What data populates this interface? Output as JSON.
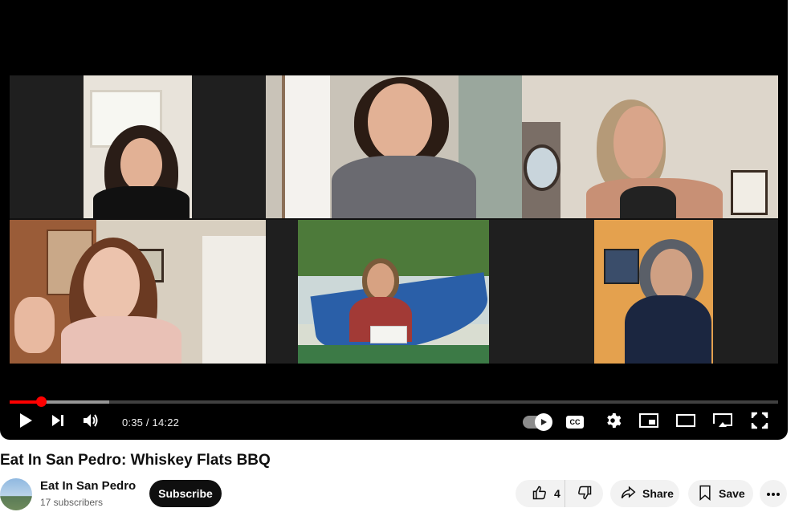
{
  "video": {
    "title": "Eat In San Pedro: Whiskey Flats BBQ",
    "current_time": "0:35",
    "duration": "14:22",
    "time_display": "0:35 / 14:22",
    "progress_played": 0.041,
    "progress_loaded": 0.13,
    "autoplay_on": true,
    "captions_label": "CC"
  },
  "channel": {
    "name": "Eat In San Pedro",
    "subscribers": "17 subscribers",
    "subscribe_label": "Subscribe"
  },
  "actions": {
    "like_count": "4",
    "share_label": "Share",
    "save_label": "Save"
  },
  "icons": {
    "play": "play-icon",
    "next": "next-icon",
    "volume": "volume-icon",
    "autoplay": "autoplay-toggle-icon",
    "captions": "captions-icon",
    "settings": "gear-icon",
    "miniplayer": "miniplayer-icon",
    "theater": "theater-mode-icon",
    "cast": "cast-icon",
    "fullscreen": "fullscreen-icon",
    "like": "thumbs-up-icon",
    "dislike": "thumbs-down-icon",
    "share": "share-icon",
    "save": "bookmark-icon",
    "more": "more-icon"
  },
  "colors": {
    "accent": "#ff0000",
    "player_bg": "#000000",
    "button_dark": "#0f0f0f",
    "pill_bg": "#f2f2f2"
  }
}
